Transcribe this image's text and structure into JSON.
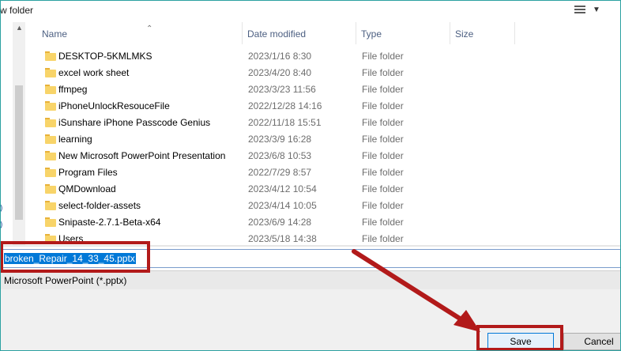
{
  "toolbar": {
    "new_folder_label": "w folder"
  },
  "columns": {
    "name": "Name",
    "date_modified": "Date modified",
    "type": "Type",
    "size": "Size"
  },
  "files": [
    {
      "name": "DESKTOP-5KMLMKS",
      "date": "2023/1/16 8:30",
      "type": "File folder"
    },
    {
      "name": "excel work sheet",
      "date": "2023/4/20 8:40",
      "type": "File folder"
    },
    {
      "name": "ffmpeg",
      "date": "2023/3/23 11:56",
      "type": "File folder"
    },
    {
      "name": "iPhoneUnlockResouceFile",
      "date": "2022/12/28 14:16",
      "type": "File folder"
    },
    {
      "name": "iSunshare iPhone Passcode Genius",
      "date": "2022/11/18 15:51",
      "type": "File folder"
    },
    {
      "name": "learning",
      "date": "2023/3/9 16:28",
      "type": "File folder"
    },
    {
      "name": "New Microsoft PowerPoint Presentation",
      "date": "2023/6/8 10:53",
      "type": "File folder"
    },
    {
      "name": "Program Files",
      "date": "2022/7/29 8:57",
      "type": "File folder"
    },
    {
      "name": "QMDownload",
      "date": "2023/4/12 10:54",
      "type": "File folder"
    },
    {
      "name": "select-folder-assets",
      "date": "2023/4/14 10:05",
      "type": "File folder"
    },
    {
      "name": "Snipaste-2.7.1-Beta-x64",
      "date": "2023/6/9 14:28",
      "type": "File folder"
    },
    {
      "name": "Users",
      "date": "2023/5/18 14:38",
      "type": "File folder"
    }
  ],
  "filename": {
    "value": "broken_Repair_14_33_45.pptx"
  },
  "save_as_type": {
    "value": "Microsoft PowerPoint (*.pptx)"
  },
  "buttons": {
    "save": "Save",
    "cancel": "Cancel"
  },
  "colors": {
    "highlight": "#b21a1a",
    "selection": "#0078d7",
    "folder": "#f8d469"
  },
  "icons": {
    "folder": "folder-icon",
    "view": "view-options-icon",
    "arrow": "annotation-arrow"
  }
}
